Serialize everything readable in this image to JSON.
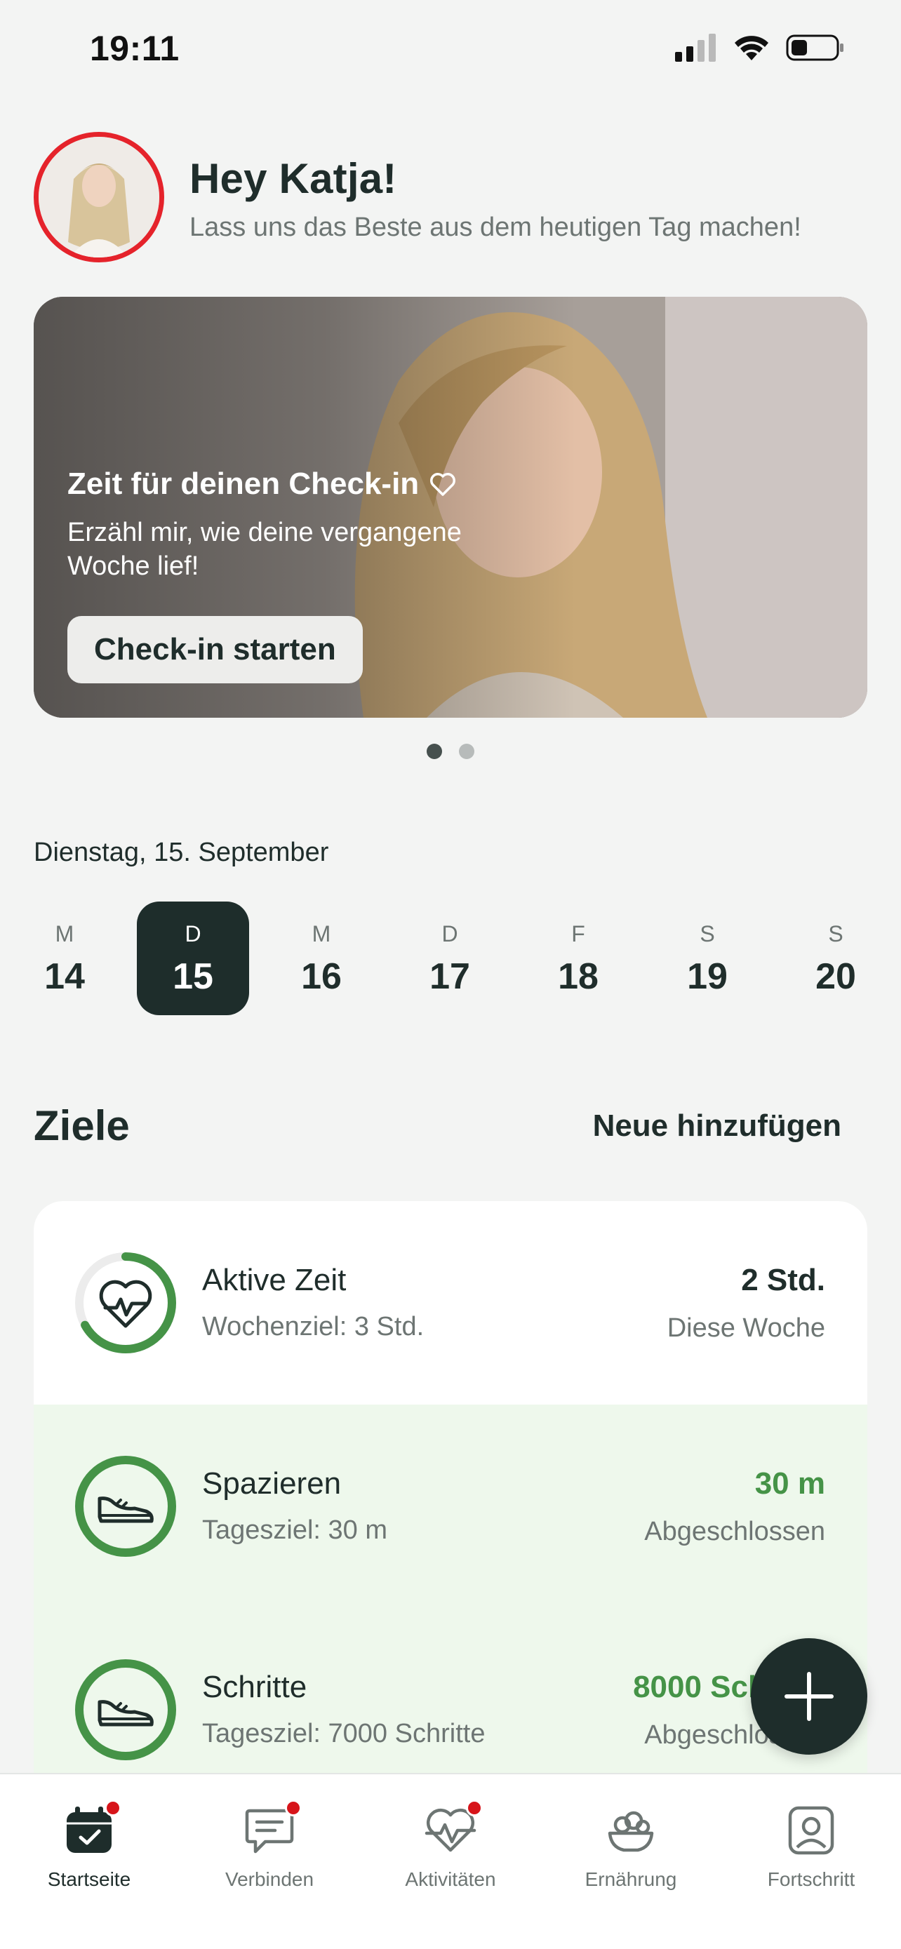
{
  "status_bar": {
    "time": "19:11",
    "icons": [
      "cellular-signal-icon",
      "wifi-icon",
      "battery-icon"
    ]
  },
  "header": {
    "greeting": "Hey Katja!",
    "subtitle": "Lass uns das Beste aus dem heutigen Tag machen!",
    "avatar_ring_color": "#e5232b"
  },
  "hero": {
    "title": "Zeit für deinen Check-in",
    "title_icon": "heart-outline-icon",
    "subtitle": "Erzähl mir, wie deine vergangene Woche lief!",
    "button": "Check-in starten",
    "page_count": 2,
    "active_page": 1
  },
  "date_label": "Dienstag, 15. September",
  "week": [
    {
      "letter": "M",
      "number": "14",
      "selected": false
    },
    {
      "letter": "D",
      "number": "15",
      "selected": true
    },
    {
      "letter": "M",
      "number": "16",
      "selected": false
    },
    {
      "letter": "D",
      "number": "17",
      "selected": false
    },
    {
      "letter": "F",
      "number": "18",
      "selected": false
    },
    {
      "letter": "S",
      "number": "19",
      "selected": false
    },
    {
      "letter": "S",
      "number": "20",
      "selected": false
    }
  ],
  "goals": {
    "title": "Ziele",
    "add_label": "Neue hinzufügen",
    "items": [
      {
        "name": "Aktive Zeit",
        "target": "Wochenziel: 3 Std.",
        "value": "2 Std.",
        "status": "Diese Woche",
        "icon": "heartbeat-icon",
        "progress": 0.67,
        "completed": false
      },
      {
        "name": "Spazieren",
        "target": "Tagesziel: 30 m",
        "value": "30 m",
        "status": "Abgeschlossen",
        "icon": "sneaker-icon",
        "progress": 1.0,
        "completed": true
      },
      {
        "name": "Schritte",
        "target": "Tagesziel: 7000 Schritte",
        "value": "8000 Schritte",
        "status": "Abgeschlossen",
        "icon": "sneaker-icon",
        "progress": 1.0,
        "completed": true
      }
    ]
  },
  "fab_icon": "plus-icon",
  "tabs": [
    {
      "label": "Startseite",
      "icon": "calendar-check-icon",
      "active": true,
      "badge": true
    },
    {
      "label": "Verbinden",
      "icon": "chat-icon",
      "active": false,
      "badge": true
    },
    {
      "label": "Aktivitäten",
      "icon": "heart-pulse-icon",
      "active": false,
      "badge": true
    },
    {
      "label": "Ernährung",
      "icon": "food-bowl-icon",
      "active": false,
      "badge": false
    },
    {
      "label": "Fortschritt",
      "icon": "profile-icon",
      "active": false,
      "badge": false
    }
  ],
  "colors": {
    "accent_dark": "#1e2d2b",
    "success_green": "#459347",
    "goal_done_bg": "#eef8ec",
    "badge_red": "#d7141a"
  }
}
